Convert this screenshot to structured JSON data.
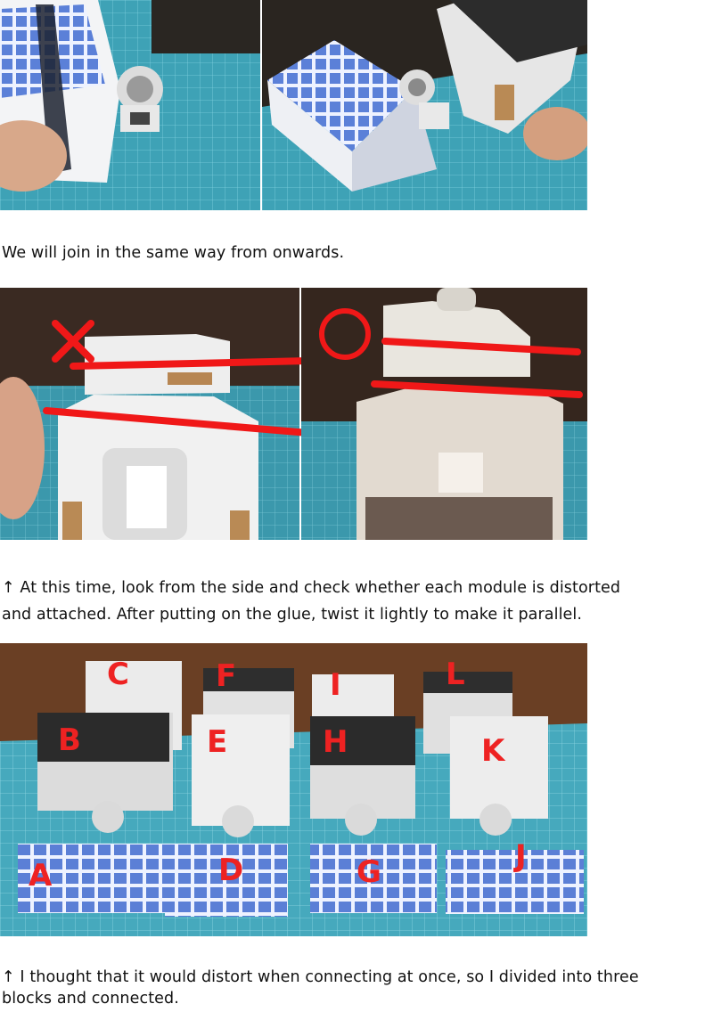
{
  "captions": {
    "c1": "We will join in the same way from onwards.",
    "c2_line1": "↑  At this time, look from the side and check whether each module is distorted",
    "c2_line2": "and attached. After putting on the glue, twist it lightly to make it parallel.",
    "c3_line1": "↑  I thought that it would distort when connecting at once, so I divided into three",
    "c3_line2": "blocks and connected."
  },
  "photo3_labels": {
    "a": "A",
    "b": "B",
    "c": "C",
    "d": "D",
    "e": "E",
    "f": "F",
    "g": "G",
    "h": "H",
    "i": "I",
    "j": "J",
    "k": "K",
    "l": "L"
  },
  "colors": {
    "cutting_mat": "#3fa3b8",
    "annotation_red": "#f01818",
    "solar_panel": "#5b7fd6"
  }
}
